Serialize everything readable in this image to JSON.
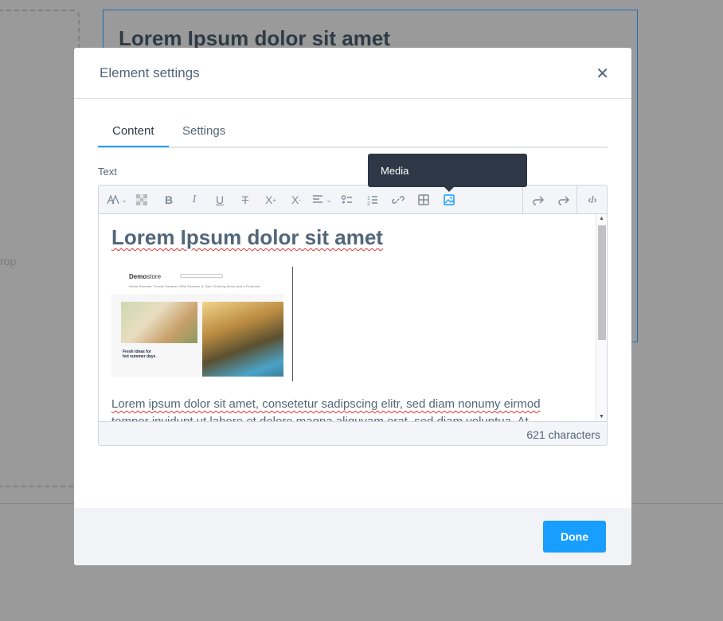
{
  "background": {
    "heading": "Lorem Ipsum dolor sit amet",
    "drop_label": "rop"
  },
  "modal": {
    "title": "Element settings",
    "close_icon": "close-icon",
    "tabs": [
      {
        "label": "Content",
        "active": true
      },
      {
        "label": "Settings",
        "active": false
      }
    ],
    "field_label": "Text",
    "tooltip": "Media",
    "toolbar": {
      "buttons": [
        "text-style-icon",
        "color-icon",
        "bold-icon",
        "italic-icon",
        "underline-icon",
        "strikethrough-icon",
        "superscript-icon",
        "subscript-icon",
        "align-icon",
        "unordered-list-icon",
        "ordered-list-icon",
        "link-icon",
        "table-icon",
        "media-icon",
        "undo-icon",
        "redo-icon",
        "code-icon"
      ],
      "active_button": "media-icon"
    },
    "editor": {
      "heading": "Lorem Ipsum dolor sit amet",
      "thumbnail": {
        "brand_bold": "Demo",
        "brand_rest": "store",
        "nav": "Home  Sammer Trends  Sammer Gifts  Sammer & Sale  Clothing Items and a Products",
        "caption_line1": "Fresh ideas for",
        "caption_line2": "hot summer days"
      },
      "paragraph": "Lorem ipsum dolor sit amet, consetetur sadipscing elitr, sed diam nonumy eirmod tempor invidunt ut labore et dolore magna aliquyam erat, sed diam voluptua. At",
      "char_count": "621 characters"
    },
    "done_label": "Done"
  },
  "colors": {
    "accent": "#189eff",
    "tooltip_bg": "#2d3745",
    "text": "#52667a",
    "overlay": "#9a9a9a"
  }
}
